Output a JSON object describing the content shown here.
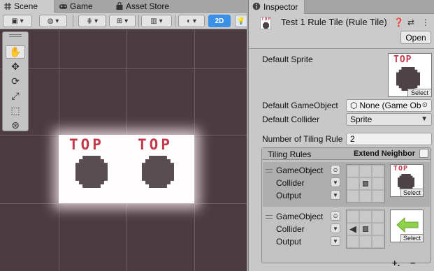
{
  "scene_tabs": [
    {
      "label": "Scene",
      "icon": "hash-icon",
      "active": true
    },
    {
      "label": "Game",
      "icon": "gamepad-icon",
      "active": false
    },
    {
      "label": "Asset Store",
      "icon": "bag-icon",
      "active": false
    }
  ],
  "scene_toolbar": {
    "mode_2d_label": "2D"
  },
  "scene_content": {
    "tile_label_1": "TOP",
    "tile_label_2": "TOP"
  },
  "tools": [
    "hand-tool",
    "move-tool",
    "rotate-tool",
    "scale-tool",
    "rect-tool",
    "transform-tool"
  ],
  "inspector": {
    "tab_label": "Inspector",
    "title": "Test 1 Rule Tile (Rule Tile)",
    "open_label": "Open",
    "default_sprite_label": "Default Sprite",
    "select_label": "Select",
    "default_gameobject_label": "Default GameObject",
    "default_gameobject_value": "None (Game Ob",
    "default_collider_label": "Default Collider",
    "default_collider_value": "Sprite",
    "tiling_rule_count_label": "Number of Tiling Rule",
    "tiling_rule_count_value": "2",
    "tiling_rules_header": "Tiling Rules",
    "extend_neighbor_label": "Extend Neighbor",
    "thumb_label": "TOP",
    "rules": [
      {
        "gameobject_label": "GameObject",
        "collider_label": "Collider",
        "output_label": "Output",
        "select_label": "Select"
      },
      {
        "gameobject_label": "GameObject",
        "collider_label": "Collider",
        "output_label": "Output",
        "select_label": "Select"
      }
    ],
    "add_label": "+.",
    "remove_label": "−"
  },
  "colors": {
    "accent_blue": "#3a8fe6",
    "tile_red": "#c23a4a",
    "arrow_green": "#8fd14a",
    "scene_bg": "#4c3c41"
  }
}
